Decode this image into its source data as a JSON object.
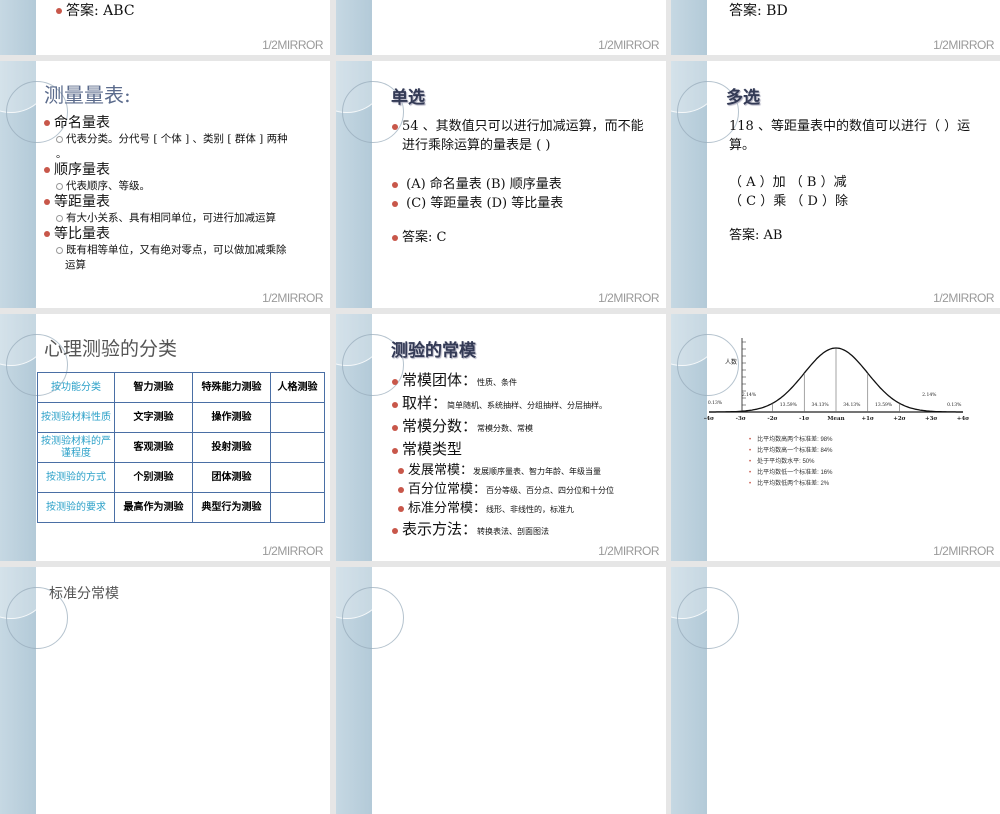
{
  "footer": "1/2MIRROR",
  "row0": {
    "left_answer": "答案:  ABC",
    "right_answer": "答案:  BD"
  },
  "scales": {
    "title": "测量量表:",
    "items": [
      {
        "label": "命名量表",
        "desc": "代表分类。分代号 [ 个体 ] 、类别 [ 群体 ] 两种",
        "desc2": "。"
      },
      {
        "label": "顺序量表",
        "desc": "代表顺序、等级。",
        "desc2": ""
      },
      {
        "label": "等距量表",
        "desc": "有大小关系、具有相同单位，可进行加减运算",
        "desc2": ""
      },
      {
        "label": "等比量表",
        "desc": "既有相等单位，又有绝对零点，可以做加减乘除",
        "desc2": "运算"
      }
    ]
  },
  "single": {
    "title": "单选",
    "question": "54 、其数值只可以进行加减运算，而不能进行乘除运算的量表是 ( )",
    "options": [
      "(A) 命名量表   (B) 顺序量表",
      "(C) 等距量表   (D) 等比量表"
    ],
    "answer": "答案:  C"
  },
  "multi": {
    "title": "多选",
    "question": "118 、等距量表中的数值可以进行（    ）运算。",
    "options": [
      "（ A ）加    （ B ）减",
      "（ C ）乘    （ D ）除"
    ],
    "answer": "答案:  AB"
  },
  "classify": {
    "title": "心理测验的分类",
    "rows": [
      [
        "按功能分类",
        "智力测验",
        "特殊能力测验",
        "人格测验"
      ],
      [
        "按测验材料性质",
        "文字测验",
        "操作测验",
        ""
      ],
      [
        "按测验材料的严谨程度",
        "客观测验",
        "投射测验",
        ""
      ],
      [
        "按测验的方式",
        "个别测验",
        "团体测验",
        ""
      ],
      [
        "按测验的要求",
        "最高作为测验",
        "典型行为测验",
        ""
      ]
    ]
  },
  "norms": {
    "title": "测验的常模",
    "items": [
      {
        "label": "常模团体：",
        "desc": "性质、条件",
        "level": 1
      },
      {
        "label": "取样：",
        "desc": "简单随机、系统抽样、分组抽样、分层抽样。",
        "level": 1
      },
      {
        "label": "常模分数：",
        "desc": "常模分数、常模",
        "level": 1
      },
      {
        "label": "常模类型",
        "desc": "",
        "level": 1
      },
      {
        "label": "发展常模：",
        "desc": "发展顺序量表、智力年龄、年级当量",
        "level": 2
      },
      {
        "label": "百分位常模：",
        "desc": "百分等级、百分点、四分位和十分位",
        "level": 2
      },
      {
        "label": "标准分常模：",
        "desc": "线形、非线性的，标准九",
        "level": 2
      },
      {
        "label": "表示方法：",
        "desc": "转换表法、剖面图法",
        "level": 1
      }
    ]
  },
  "chart_data": {
    "type": "line",
    "title": "",
    "ylabel": "人数",
    "x_ticks": [
      "-4σ",
      "-3σ",
      "-2σ",
      "-1σ",
      "Mean",
      "+1σ",
      "+2σ",
      "+3σ",
      "+4σ"
    ],
    "region_labels": [
      "0.13%",
      "2.14%",
      "13.59%",
      "34.13%",
      "34.13%",
      "13.59%",
      "2.14%",
      "0.13%"
    ],
    "legend": [
      "比平均数高两个标准差:  98%",
      "比平均数高一个标准差:  84%",
      "处于平均数水平:  50%",
      "比平均数低一个标准差:  16%",
      "比平均数低两个标准差:  2%"
    ]
  },
  "std_norm": {
    "title": "标准分常模"
  }
}
